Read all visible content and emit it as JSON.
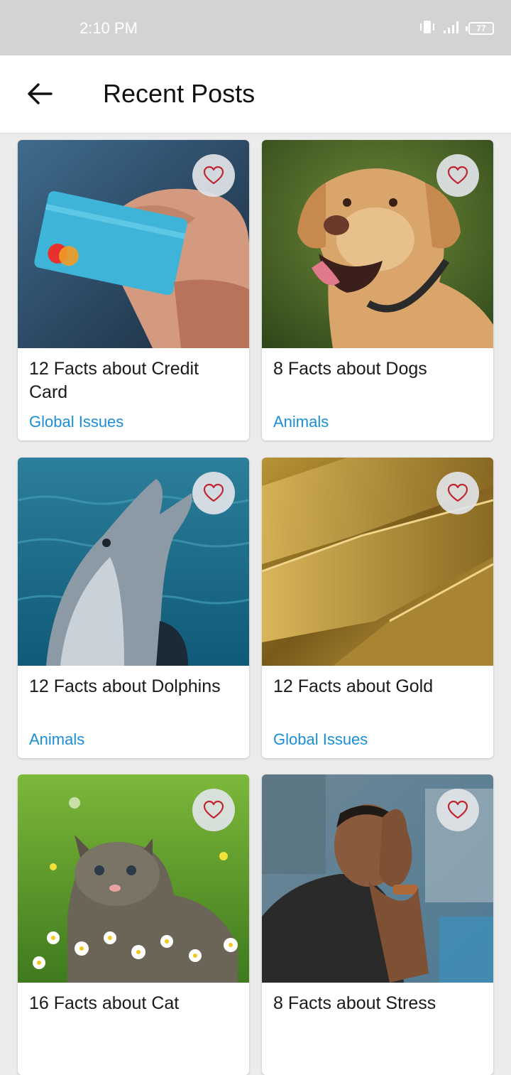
{
  "status_bar": {
    "time": "2:10 PM",
    "battery": "77",
    "icons": [
      "vibrate-icon",
      "signal-icon",
      "battery-icon"
    ]
  },
  "header": {
    "back_icon": "arrow-left-icon",
    "title": "Recent Posts"
  },
  "colors": {
    "category": "#1a8fd8",
    "heart": "#c0262f",
    "fav_bg": "#e1e4e8"
  },
  "posts": [
    {
      "title": "12 Facts about Credit Card",
      "category": "Global Issues",
      "image": "credit-card-photo"
    },
    {
      "title": "8 Facts about Dogs",
      "category": "Animals",
      "image": "dog-photo"
    },
    {
      "title": "12 Facts about Dolphins",
      "category": "Animals",
      "image": "dolphin-photo"
    },
    {
      "title": "12 Facts about Gold",
      "category": "Global Issues",
      "image": "gold-photo"
    },
    {
      "title": "16 Facts about Cat",
      "category": "",
      "image": "kitten-photo"
    },
    {
      "title": "8 Facts about Stress",
      "category": "",
      "image": "stress-photo"
    }
  ]
}
